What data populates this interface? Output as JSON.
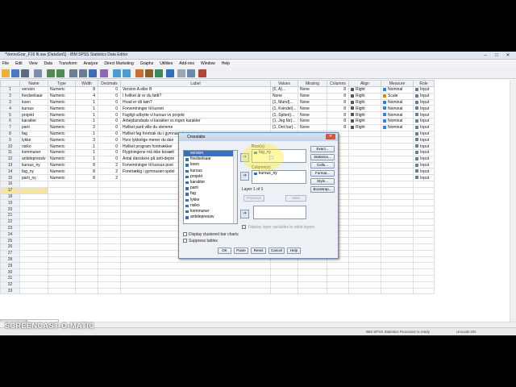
{
  "window": {
    "title": "*VennsGrar_F16 fil.sav [DataSet1] - IBM SPSS Statistics Data Editor",
    "controls": [
      "–",
      "□",
      "✕"
    ]
  },
  "menu": [
    "File",
    "Edit",
    "View",
    "Data",
    "Transform",
    "Analyze",
    "Direct Marketing",
    "Graphs",
    "Utilities",
    "Add-ons",
    "Window",
    "Help"
  ],
  "toolbar_icons": [
    "open-icon",
    "save-icon",
    "print-icon",
    "dialog-recall-icon",
    "undo-icon",
    "redo-icon",
    "goto-case-icon",
    "goto-variable-icon",
    "variables-icon",
    "find-icon",
    "insert-cases-icon",
    "insert-variable-icon",
    "split-file-icon",
    "weight-cases-icon",
    "select-cases-icon",
    "value-labels-icon",
    "use-sets-icon",
    "show-all-icon",
    "spelling-icon"
  ],
  "columns": [
    "Name",
    "Type",
    "Width",
    "Decimals",
    "Label",
    "Values",
    "Missing",
    "Columns",
    "Align",
    "Measure",
    "Role"
  ],
  "rows": [
    {
      "n": "1",
      "name": "version",
      "type": "Numeric",
      "width": "8",
      "dec": "0",
      "label": "Version A eller B",
      "values": "{0, A}...",
      "missing": "None",
      "columns": "8",
      "align": "Right",
      "measure": "Nominal",
      "role": "Input"
    },
    {
      "n": "2",
      "name": "foedselsaar",
      "type": "Numeric",
      "width": "4",
      "dec": "0",
      "label": "I hvilket år er du født?",
      "values": "None",
      "missing": "None",
      "columns": "8",
      "align": "Right",
      "measure": "Scale",
      "role": "Input"
    },
    {
      "n": "3",
      "name": "koen",
      "type": "Numeric",
      "width": "1",
      "dec": "0",
      "label": "Hvad er dit køn?",
      "values": "{1, Mand}...",
      "missing": "None",
      "columns": "8",
      "align": "Right",
      "measure": "Nominal",
      "role": "Input"
    },
    {
      "n": "4",
      "name": "kursus",
      "type": "Numeric",
      "width": "1",
      "dec": "0",
      "label": "Forventninger til kurset",
      "values": "{1, Kvindel}...",
      "missing": "None",
      "columns": "8",
      "align": "Right",
      "measure": "Nominal",
      "role": "Input"
    },
    {
      "n": "5",
      "name": "projekt",
      "type": "Numeric",
      "width": "1",
      "dec": "0",
      "label": "Fagligt udbytte vi kursus vs projekt",
      "values": "{1, Spiteri}...",
      "missing": "None",
      "columns": "8",
      "align": "Right",
      "measure": "Nominal",
      "role": "Input"
    },
    {
      "n": "6",
      "name": "karakter",
      "type": "Numeric",
      "width": "1",
      "dec": "0",
      "label": "Arbejdsindsats vi karakter vs ingen karakter",
      "values": "{1, Jeg får}...",
      "missing": "None",
      "columns": "8",
      "align": "Right",
      "measure": "Nominal",
      "role": "Input"
    },
    {
      "n": "7",
      "name": "parti",
      "type": "Numeric",
      "width": "2",
      "dec": "0",
      "label": "Hvilket parti ville du stemme",
      "values": "{1, Det har}...",
      "missing": "None",
      "columns": "8",
      "align": "Right",
      "measure": "Nominal",
      "role": "Input"
    },
    {
      "n": "8",
      "name": "fag",
      "type": "Numeric",
      "width": "1",
      "dec": "0",
      "label": "Hvilket fag foretrak du i gymnasiet",
      "values": "",
      "missing": "",
      "columns": "",
      "align": "",
      "measure": "",
      "role": "Input"
    },
    {
      "n": "9",
      "name": "lykke",
      "type": "Numeric",
      "width": "3",
      "dec": "0",
      "label": "Hvor lykkelige mener du dan",
      "values": "",
      "missing": "",
      "columns": "",
      "align": "",
      "measure": "",
      "role": "Input"
    },
    {
      "n": "10",
      "name": "risiko",
      "type": "Numeric",
      "width": "1",
      "dec": "0",
      "label": "Hvilket program foretrækker",
      "values": "",
      "missing": "",
      "columns": "",
      "align": "",
      "measure": "",
      "role": "Input"
    },
    {
      "n": "11",
      "name": "kommuner",
      "type": "Numeric",
      "width": "1",
      "dec": "0",
      "label": "Flygtningene må ikke bosætt",
      "values": "",
      "missing": "",
      "columns": "",
      "align": "",
      "measure": "",
      "role": "Input"
    },
    {
      "n": "12",
      "name": "antidepressiv",
      "type": "Numeric",
      "width": "1",
      "dec": "0",
      "label": "Antal danskere på anti-depre",
      "values": "",
      "missing": "",
      "columns": "",
      "align": "",
      "measure": "",
      "role": "Input"
    },
    {
      "n": "13",
      "name": "kursus_ny",
      "type": "Numeric",
      "width": "8",
      "dec": "2",
      "label": "Forventninger til kursus post",
      "values": "",
      "missing": "",
      "columns": "",
      "align": "",
      "measure": "",
      "role": "Input"
    },
    {
      "n": "14",
      "name": "fag_ny",
      "type": "Numeric",
      "width": "8",
      "dec": "2",
      "label": "Foretrækig i gymnasiet opdel",
      "values": "",
      "missing": "",
      "columns": "",
      "align": "",
      "measure": "",
      "role": "Input"
    },
    {
      "n": "15",
      "name": "parti_ny",
      "type": "Numeric",
      "width": "8",
      "dec": "2",
      "label": "",
      "values": "",
      "missing": "",
      "columns": "",
      "align": "",
      "measure": "",
      "role": "Input"
    }
  ],
  "empty_row_numbers": [
    "16",
    "17",
    "18",
    "19",
    "20",
    "21",
    "22",
    "23",
    "24",
    "25",
    "26",
    "27",
    "28",
    "29",
    "30",
    "31",
    "32",
    "33"
  ],
  "sheet_tabs": {
    "data_view": "Data View",
    "variable_view": "Variable View"
  },
  "status": {
    "processor": "IBM SPSS Statistics Processor is ready",
    "unicode": "Unicode:ON"
  },
  "dialog": {
    "title": "Crosstabs",
    "close": "✕",
    "variables": [
      "version",
      "foedselsaar",
      "koen",
      "kursus",
      "projekt",
      "karakter",
      "parti",
      "fag",
      "lykke",
      "risiko",
      "kommuner",
      "antidepressiv"
    ],
    "rows_label": "Row(s):",
    "rows_values": [
      "fag_ny"
    ],
    "columns_label": "Column(s):",
    "columns_values": [
      "kursus_ny"
    ],
    "layer_label": "Layer 1 of 1",
    "previous": "Previous",
    "next": "Next",
    "display_layer": "Display layer variables in table layers",
    "side_buttons": [
      "Exact...",
      "Statistics...",
      "Cells...",
      "Format...",
      "Style...",
      "Bootstrap..."
    ],
    "clustered": "Display clustered bar charts",
    "suppress": "Suppress tables",
    "bottom_buttons": [
      "OK",
      "Paste",
      "Reset",
      "Cancel",
      "Help"
    ]
  },
  "watermark": {
    "line1": "RECORDED WITH",
    "line2": "SCREENCAST-O-MATIC"
  },
  "colors": {
    "accent": "#3a6fc9",
    "selected_row": "#f4e3a3",
    "nominal": "#3c7dd4",
    "scale": "#d08a1a"
  }
}
